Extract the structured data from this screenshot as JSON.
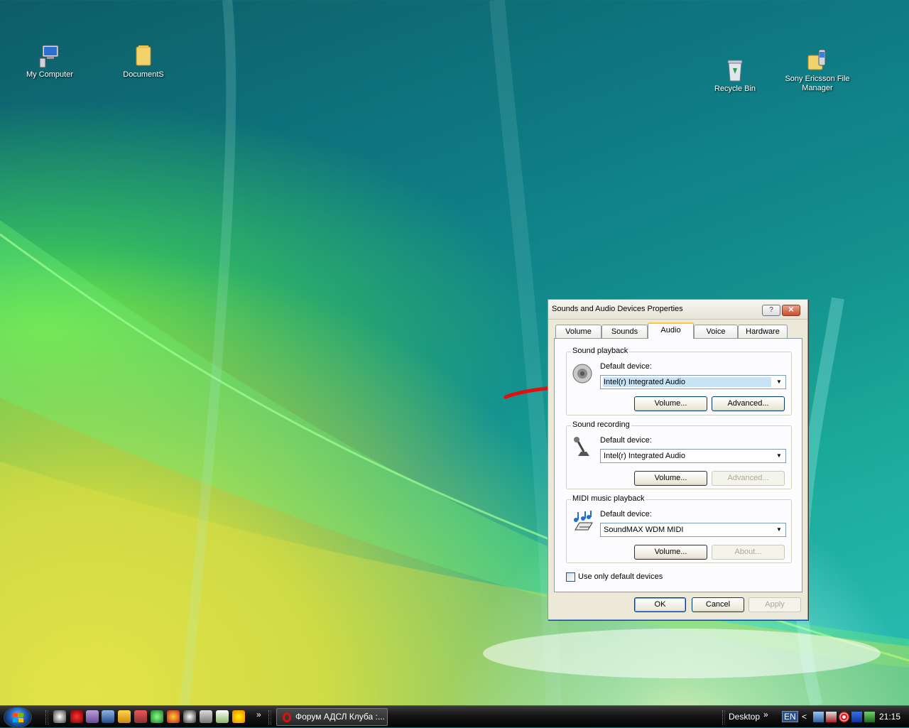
{
  "desktop": {
    "icons": [
      {
        "label": "My Computer",
        "icon": "computer-icon"
      },
      {
        "label": "DocumentS",
        "icon": "folder-icon"
      },
      {
        "label": "Recycle Bin",
        "icon": "recycle-bin-icon"
      },
      {
        "label": "Sony Ericsson File Manager",
        "icon": "phone-folder-icon"
      }
    ]
  },
  "dialog": {
    "title": "Sounds and Audio Devices Properties",
    "help_label": "?",
    "close_label": "✕",
    "tabs": [
      {
        "label": "Volume"
      },
      {
        "label": "Sounds"
      },
      {
        "label": "Audio",
        "active": true
      },
      {
        "label": "Voice"
      },
      {
        "label": "Hardware"
      }
    ],
    "sections": [
      {
        "label": "Sound playback",
        "icon": "speaker-icon",
        "device_label": "Default device:",
        "device_value": "Intel(r) Integrated Audio",
        "buttons": [
          {
            "label": "Volume...",
            "enabled": true
          },
          {
            "label": "Advanced...",
            "enabled": true
          }
        ]
      },
      {
        "label": "Sound recording",
        "icon": "microphone-icon",
        "device_label": "Default device:",
        "device_value": "Intel(r) Integrated Audio",
        "buttons": [
          {
            "label": "Volume...",
            "enabled": true
          },
          {
            "label": "Advanced...",
            "enabled": false
          }
        ]
      },
      {
        "label": "MIDI music playback",
        "icon": "music-notes-icon",
        "device_label": "Default device:",
        "device_value": "SoundMAX WDM MIDI",
        "buttons": [
          {
            "label": "Volume...",
            "enabled": true
          },
          {
            "label": "About...",
            "enabled": false
          }
        ]
      }
    ],
    "checkbox": {
      "label": "Use only default devices",
      "checked": false
    },
    "footer": {
      "ok": "OK",
      "cancel": "Cancel",
      "apply": "Apply"
    }
  },
  "taskbar": {
    "task_label": "Форум АДСЛ Клуба :...",
    "more_label": "»",
    "desktop_label": "Desktop",
    "desktop_more": "»",
    "lang": "EN",
    "tray_chevron": "<",
    "clock": "21:15"
  },
  "colors": {
    "annotation_arrow": "#e01010",
    "tab_highlight": "#ffc83c"
  }
}
